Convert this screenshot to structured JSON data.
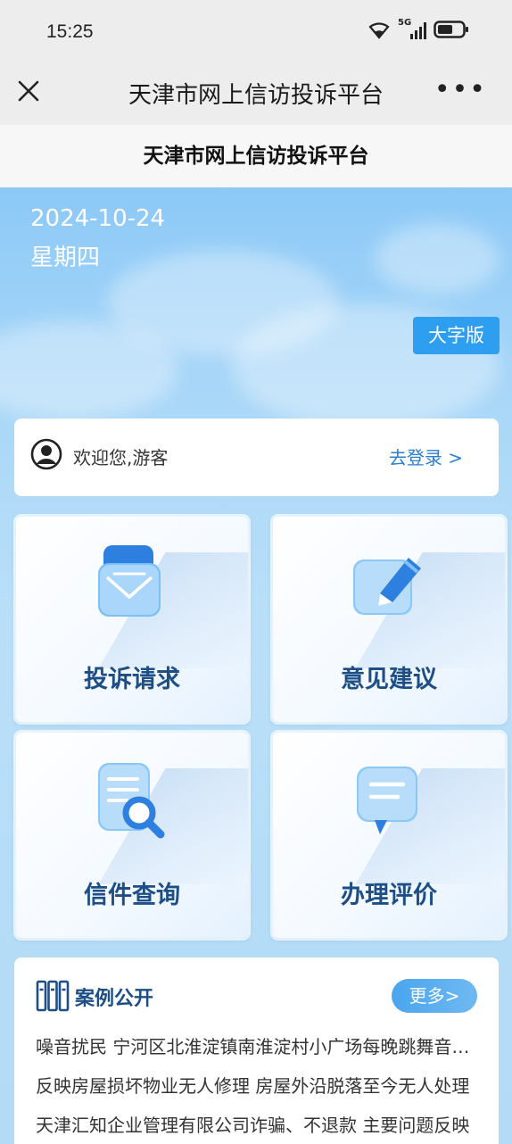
{
  "status": {
    "time": "15:25",
    "network": "5G"
  },
  "nav": {
    "title": "天津市网上信访投诉平台"
  },
  "header": {
    "title": "天津市网上信访投诉平台"
  },
  "banner": {
    "date": "2024-10-24",
    "weekday": "星期四",
    "bigfont_label": "大字版"
  },
  "welcome": {
    "text": "欢迎您,游客",
    "login_label": "去登录 >"
  },
  "tiles": [
    {
      "label": "投诉请求",
      "icon": "envelope-icon"
    },
    {
      "label": "意见建议",
      "icon": "edit-icon"
    },
    {
      "label": "信件查询",
      "icon": "document-search-icon"
    },
    {
      "label": "办理评价",
      "icon": "comment-icon"
    }
  ],
  "cases": {
    "title": "案例公开",
    "more_label": "更多>",
    "items": [
      "噪音扰民 宁河区北淮淀镇南淮淀村小广场每晚跳舞音响声音过大",
      "反映房屋损坏物业无人修理 房屋外沿脱落至今无人处理",
      "天津汇知企业管理有限公司诈骗、不退款 主要问题反映"
    ]
  },
  "colors": {
    "accent": "#2e9ef0",
    "title_blue": "#1d4f86",
    "link": "#2b7fd1"
  }
}
